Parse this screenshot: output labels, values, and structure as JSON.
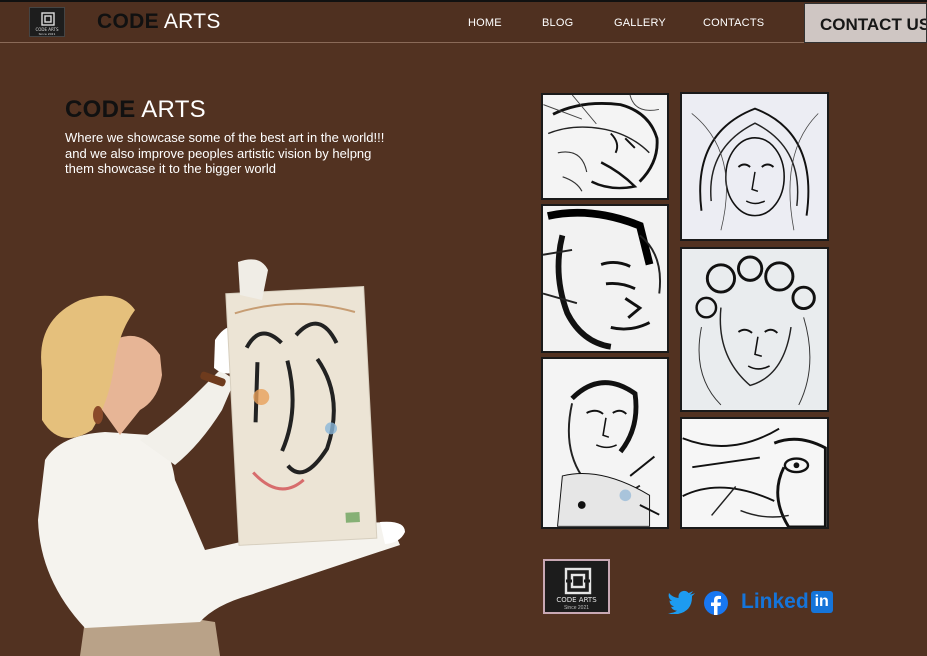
{
  "header": {
    "logo": {
      "name": "CODE ARTS",
      "since": "Since 2021"
    },
    "brand": {
      "dark": "CODE",
      "light": "ARTS"
    },
    "nav": [
      {
        "label": "HOME"
      },
      {
        "label": "BLOG"
      },
      {
        "label": "GALLERY"
      },
      {
        "label": "CONTACTS"
      }
    ],
    "cta_label": "CONTACT US"
  },
  "hero": {
    "title_dark": "CODE",
    "title_light": "ARTS",
    "lines": [
      "Where  we showcase some of the best art in the world!!!",
      "and we also improve peoples artistic vision  by helpng",
      "them showcase it to the bigger world"
    ],
    "image_icon": "woman-holding-painting"
  },
  "gallery": {
    "items": [
      {
        "icon": "portrait-sketch-man"
      },
      {
        "icon": "portrait-sketch-woman-veil"
      },
      {
        "icon": "portrait-sketch-ink-face"
      },
      {
        "icon": "portrait-sketch-curly-hair"
      },
      {
        "icon": "portrait-sketch-woman-splatter"
      },
      {
        "icon": "portrait-sketch-eye-abstract"
      }
    ]
  },
  "footer": {
    "logo": {
      "name": "CODE ARTS",
      "since": "Since 2021"
    },
    "social": [
      {
        "icon": "twitter-icon"
      },
      {
        "icon": "facebook-icon"
      },
      {
        "icon": "linkedin-icon",
        "label": "Linked",
        "badge": "in"
      }
    ]
  },
  "colors": {
    "background": "#523221",
    "contact_button": "#cfc6c3",
    "social_blue": "#1574d9",
    "twitter_blue": "#1d9bf0"
  }
}
